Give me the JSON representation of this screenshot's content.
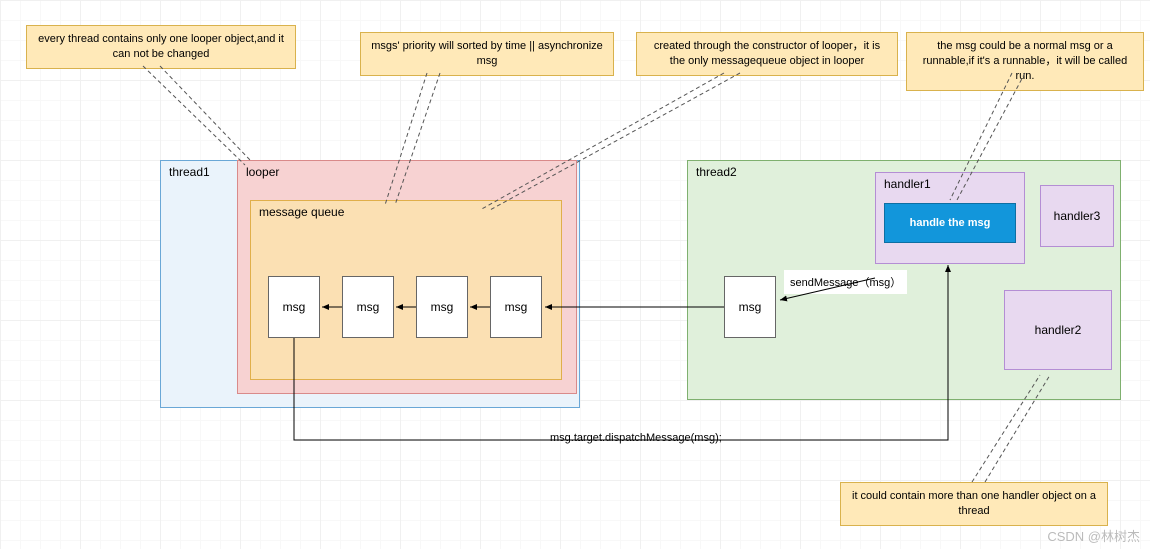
{
  "notes": {
    "n1": "every thread contains only one looper object,and it can not be changed",
    "n2": "msgs' priority will sorted by time || asynchronize msg",
    "n3": "created through the constructor of looper，it is the only messagequeue object in looper",
    "n4": "the msg could be a normal msg or a runnable,if it's a runnable，it will be called run.",
    "n5": "it could contain more than one handler object on a thread"
  },
  "boxes": {
    "thread1": "thread1",
    "looper": "looper",
    "mq": "message queue",
    "thread2": "thread2",
    "handler1": "handler1",
    "handler2": "handler2",
    "handler3": "handler3",
    "handle_btn": "handle the msg",
    "msg": "msg"
  },
  "edges": {
    "send": "sendMessage（msg）",
    "dispatch": "msg.target.dispatchMessage(msg);"
  },
  "watermark": "CSDN @林树杰"
}
